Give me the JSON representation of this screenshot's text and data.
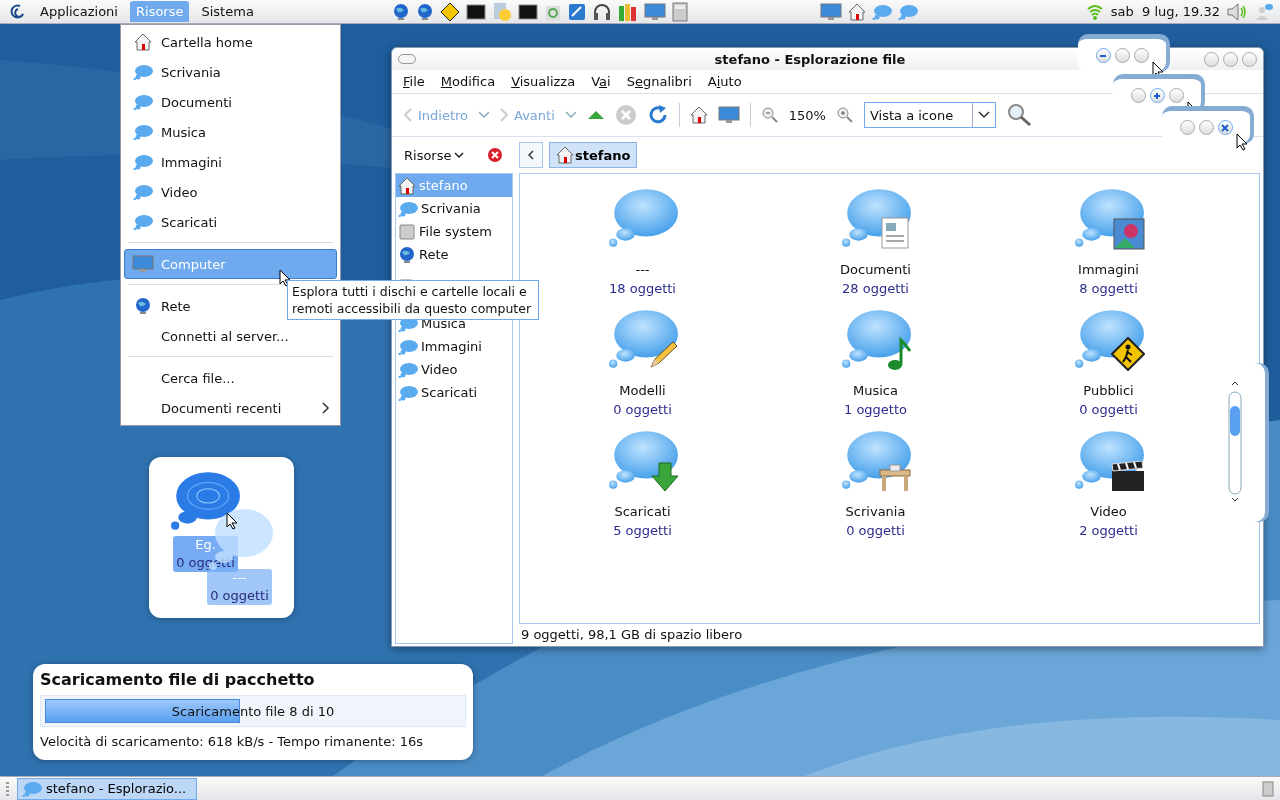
{
  "top_panel": {
    "menus": [
      {
        "label": "Applicazioni",
        "selected": false
      },
      {
        "label": "Risorse",
        "selected": true
      },
      {
        "label": "Sistema",
        "selected": false
      }
    ],
    "clock": "sab  9 lug, 19.32"
  },
  "places_menu": {
    "items": [
      {
        "kind": "item",
        "label": "Cartella home",
        "selected": false
      },
      {
        "kind": "item",
        "label": "Scrivania",
        "selected": false
      },
      {
        "kind": "item",
        "label": "Documenti",
        "selected": false
      },
      {
        "kind": "item",
        "label": "Musica",
        "selected": false
      },
      {
        "kind": "item",
        "label": "Immagini",
        "selected": false
      },
      {
        "kind": "item",
        "label": "Video",
        "selected": false
      },
      {
        "kind": "item",
        "label": "Scaricati",
        "selected": false
      },
      {
        "kind": "separator"
      },
      {
        "kind": "item",
        "label": "Computer",
        "selected": true
      },
      {
        "kind": "separator"
      },
      {
        "kind": "item",
        "label": "Rete",
        "selected": false
      },
      {
        "kind": "item",
        "label": "Connetti al server...",
        "selected": false
      },
      {
        "kind": "separator"
      },
      {
        "kind": "item",
        "label": "Cerca file...",
        "selected": false
      },
      {
        "kind": "submenu",
        "label": "Documenti recenti",
        "selected": false
      }
    ]
  },
  "tooltip": "Esplora tutti i dischi e cartelle locali e remoti accessibili da questo computer",
  "file_manager": {
    "title": "stefano - Esplorazione file",
    "menu": [
      "File",
      "Modifica",
      "Visualizza",
      "Vai",
      "Segnalibri",
      "Aiuto"
    ],
    "toolbar": {
      "back": {
        "label": "Indietro",
        "disabled": true
      },
      "forward": {
        "label": "Avanti",
        "disabled": true
      },
      "zoom": "150%",
      "view": "Vista a icone"
    },
    "side_pane": {
      "title": "Risorse",
      "items": [
        {
          "label": "stefano",
          "selected": true
        },
        {
          "label": "Scrivania",
          "selected": false
        },
        {
          "label": "File system",
          "selected": false
        },
        {
          "label": "Rete",
          "selected": false
        },
        {
          "label": "Musica",
          "selected": false
        },
        {
          "label": "Immagini",
          "selected": false
        },
        {
          "label": "Video",
          "selected": false
        },
        {
          "label": "Scaricati",
          "selected": false
        }
      ]
    },
    "path": [
      {
        "label": "stefano",
        "selected": true
      }
    ],
    "items": [
      {
        "name": "---",
        "count": "18 oggetti"
      },
      {
        "name": "Documenti",
        "count": "28 oggetti"
      },
      {
        "name": "Immagini",
        "count": "8 oggetti"
      },
      {
        "name": "Modelli",
        "count": "0 oggetti"
      },
      {
        "name": "Musica",
        "count": "1 oggetto"
      },
      {
        "name": "Pubblici",
        "count": "0 oggetti"
      },
      {
        "name": "Scaricati",
        "count": "5 oggetti"
      },
      {
        "name": "Scrivania",
        "count": "0 oggetti"
      },
      {
        "name": "Video",
        "count": "2 oggetti"
      }
    ],
    "status": "9 oggetti, 98,1 GB di spazio libero"
  },
  "drag_card": {
    "items": [
      {
        "name": "Eg.",
        "count": "0 oggetti"
      },
      {
        "name": "---",
        "count": "0 oggetti"
      }
    ]
  },
  "notification": {
    "title": "Scaricamento file di pacchetto",
    "progress": {
      "level": 0.46,
      "text": "Scaricamento file 8 di 10"
    },
    "details": "Velocità di scaricamento: 618 kB/s - Tempo rimanente: 16s"
  },
  "taskbar": {
    "tasks": [
      {
        "label": "stefano - Esplorazio...",
        "selected": true
      }
    ]
  }
}
